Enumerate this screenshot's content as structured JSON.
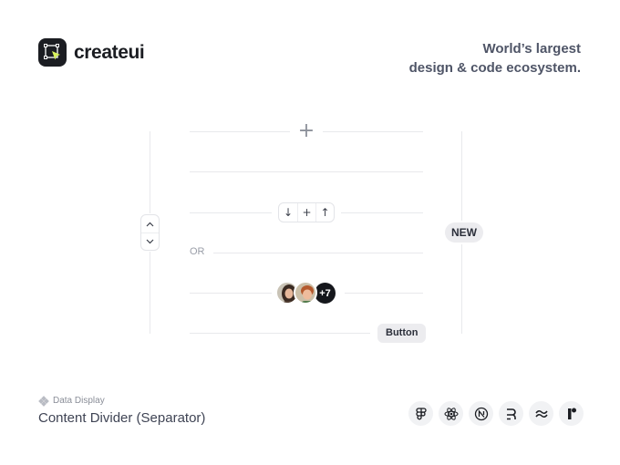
{
  "brand": {
    "name": "createui",
    "logo_icon": "cursor-select-icon"
  },
  "tagline": {
    "line1": "World’s largest",
    "line2": "design & code ecosystem."
  },
  "showcase": {
    "plus_icon": "plus-icon",
    "button_group": [
      {
        "icon": "arrow-down-icon",
        "glyph": "↓"
      },
      {
        "icon": "plus-icon",
        "glyph": "+"
      },
      {
        "icon": "arrow-up-icon",
        "glyph": "↑"
      }
    ],
    "stepper": [
      {
        "icon": "chevron-up-icon",
        "glyph": "⌃"
      },
      {
        "icon": "chevron-down-icon",
        "glyph": "⌄"
      }
    ],
    "or_label": "OR",
    "badge": "NEW",
    "avatars_more": "+7",
    "button_label": "Button"
  },
  "footer": {
    "category": "Data Display",
    "title": "Content Divider (Separator)",
    "tech_icons": [
      "figma-icon",
      "react-icon",
      "nextjs-icon",
      "remix-icon",
      "tailwind-icon",
      "framer-icon"
    ]
  },
  "colors": {
    "text_dark": "#1b1d22",
    "divider": "#e8e9ec",
    "chip_bg": "#f1f2f4"
  }
}
